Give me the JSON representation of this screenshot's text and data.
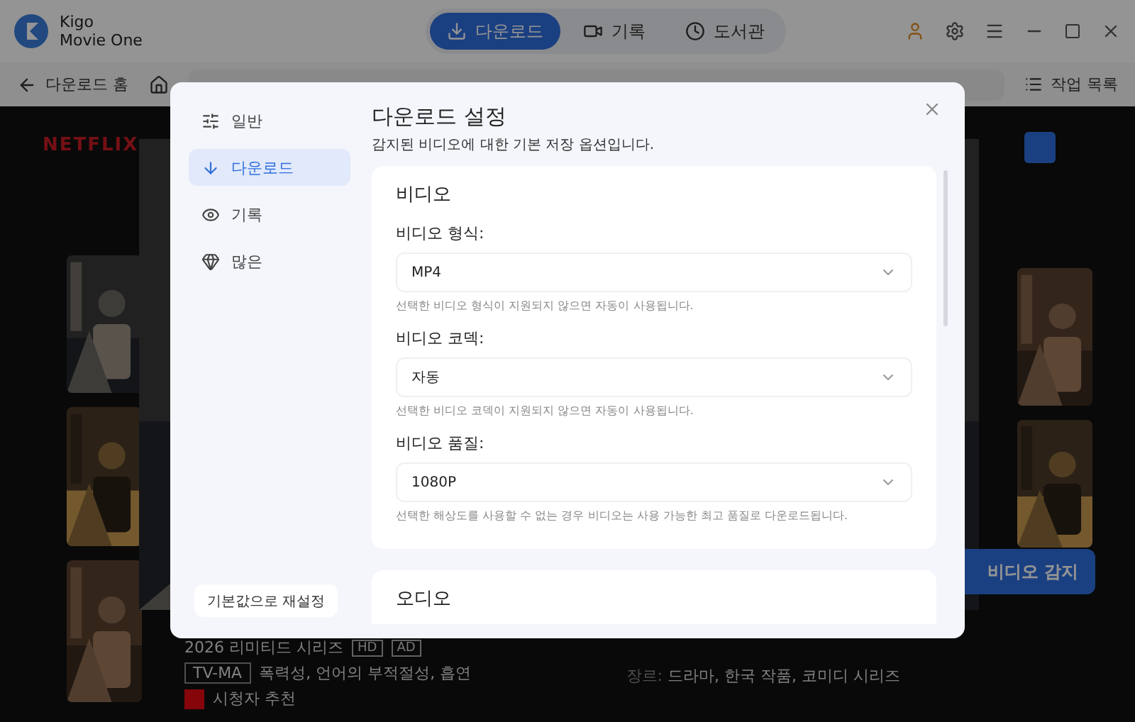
{
  "app": {
    "name": "Kigo",
    "subtitle": "Movie One"
  },
  "tabs": [
    {
      "label": "다운로드",
      "kind": "download",
      "selected": true
    },
    {
      "label": "기록",
      "kind": "video",
      "selected": false
    },
    {
      "label": "도서관",
      "kind": "clock",
      "selected": false
    }
  ],
  "nav": {
    "back": "다운로드 홈",
    "task_list": "작업 목록"
  },
  "background": {
    "logo": "NETFLIX",
    "detect_button": "비디오 감지",
    "year_type": "2026 리미티드 시리즈",
    "badges": [
      "HD",
      "AD"
    ],
    "rating": "TV-MA",
    "advisory": "폭력성, 언어의 부적절성, 흡연",
    "recommend": "시청자 추천",
    "genre_label": "장르:",
    "genres": "드라마, 한국 작품, 코미디 시리즈"
  },
  "dialog": {
    "sidebar": [
      {
        "label": "일반",
        "kind": "sliders",
        "selected": false
      },
      {
        "label": "다운로드",
        "kind": "download",
        "selected": true
      },
      {
        "label": "기록",
        "kind": "eye",
        "selected": false
      },
      {
        "label": "많은",
        "kind": "gem",
        "selected": false
      }
    ],
    "reset": "기본값으로 재설정",
    "title": "다운로드 설정",
    "subtitle": "감지된 비디오에 대한 기본 저장 옵션입니다.",
    "sections": [
      {
        "title": "비디오",
        "fields": [
          {
            "label": "비디오 형식:",
            "value": "MP4",
            "hint": "선택한 비디오 형식이 지원되지 않으면 자동이 사용됩니다."
          },
          {
            "label": "비디오 코덱:",
            "value": "자동",
            "hint": "선택한 비디오 코덱이 지원되지 않으면 자동이 사용됩니다."
          },
          {
            "label": "비디오 품질:",
            "value": "1080P",
            "hint": "선택한 해상도를 사용할 수 없는 경우 비디오는 사용 가능한 최고 품질로 다운로드됩니다."
          }
        ]
      },
      {
        "title": "오디오"
      }
    ]
  }
}
